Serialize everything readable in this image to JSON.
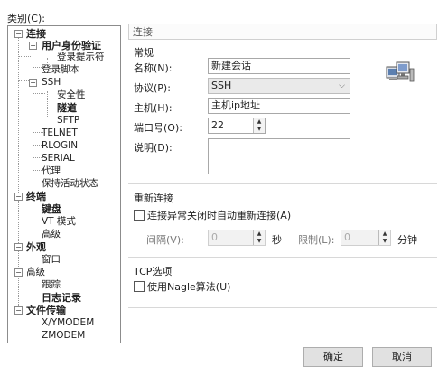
{
  "category_label": "类别(C):",
  "tree": {
    "items": [
      {
        "label": "连接",
        "toggle": "−"
      },
      {
        "label": "用户身份验证",
        "toggle": "−"
      },
      {
        "label": "登录提示符"
      },
      {
        "label": "登录脚本"
      },
      {
        "label": "SSH",
        "toggle": "−"
      },
      {
        "label": "安全性"
      },
      {
        "label": "隧道"
      },
      {
        "label": "SFTP"
      },
      {
        "label": "TELNET"
      },
      {
        "label": "RLOGIN"
      },
      {
        "label": "SERIAL"
      },
      {
        "label": "代理"
      },
      {
        "label": "保持活动状态"
      },
      {
        "label": "终端",
        "toggle": "−"
      },
      {
        "label": "键盘"
      },
      {
        "label": "VT 模式"
      },
      {
        "label": "高级"
      },
      {
        "label": "外观",
        "toggle": "−"
      },
      {
        "label": "窗口"
      },
      {
        "label": "高级",
        "toggle": "−"
      },
      {
        "label": "跟踪"
      },
      {
        "label": "日志记录"
      },
      {
        "label": "文件传输",
        "toggle": "−"
      },
      {
        "label": "X/YMODEM"
      },
      {
        "label": "ZMODEM"
      }
    ]
  },
  "panel_title": "连接",
  "general": {
    "title": "常规",
    "name_label": "名称(N):",
    "name_value": "新建会话",
    "protocol_label": "协议(P):",
    "protocol_value": "SSH",
    "host_label": "主机(H):",
    "host_value": "主机ip地址",
    "port_label": "端口号(O):",
    "port_value": "22",
    "desc_label": "说明(D):",
    "desc_value": ""
  },
  "reconnect": {
    "title": "重新连接",
    "checkbox_label": "连接异常关闭时自动重新连接(A)",
    "interval_label": "间隔(V):",
    "interval_value": "0",
    "interval_unit": "秒",
    "limit_label": "限制(L):",
    "limit_value": "0",
    "limit_unit": "分钟"
  },
  "tcp": {
    "title": "TCP选项",
    "nagle_label": "使用Nagle算法(U)"
  },
  "buttons": {
    "ok": "确定",
    "cancel": "取消"
  }
}
